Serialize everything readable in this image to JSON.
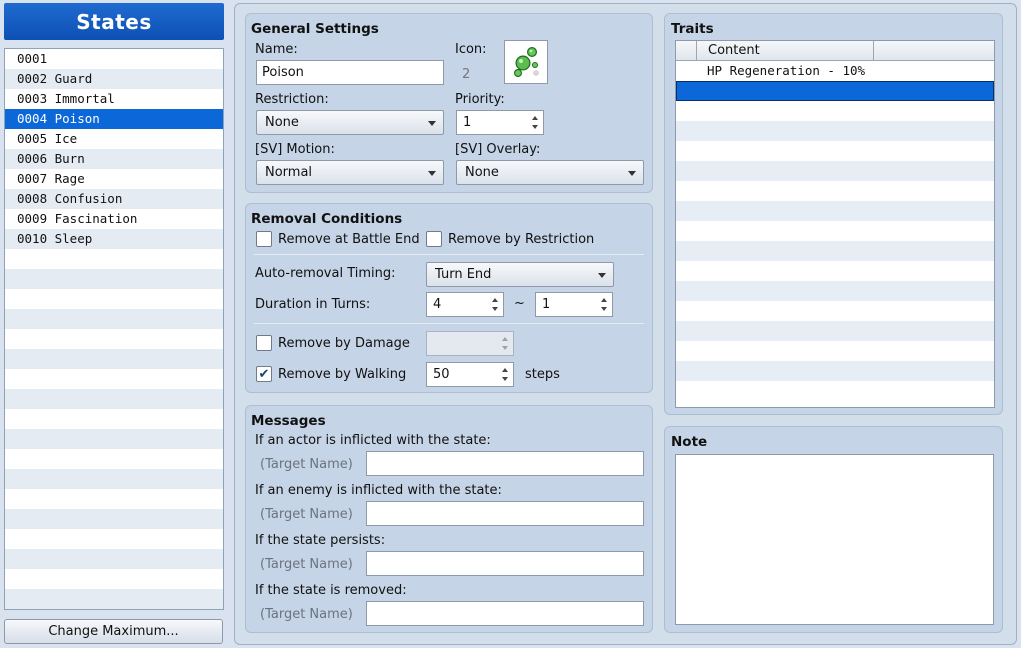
{
  "sidebar": {
    "title": "States",
    "items": [
      {
        "label": "0001"
      },
      {
        "label": "0002 Guard"
      },
      {
        "label": "0003 Immortal"
      },
      {
        "label": "0004 Poison",
        "selected": true
      },
      {
        "label": "0005 Ice"
      },
      {
        "label": "0006 Burn"
      },
      {
        "label": "0007 Rage"
      },
      {
        "label": "0008 Confusion"
      },
      {
        "label": "0009 Fascination"
      },
      {
        "label": "0010 Sleep"
      }
    ],
    "change_max_label": "Change Maximum..."
  },
  "general": {
    "title": "General Settings",
    "name_label": "Name:",
    "name_value": "Poison",
    "icon_label": "Icon:",
    "icon_index": "2",
    "icon_name": "poison-bubble-icon",
    "restriction_label": "Restriction:",
    "restriction_value": "None",
    "priority_label": "Priority:",
    "priority_value": "1",
    "sv_motion_label": "[SV] Motion:",
    "sv_motion_value": "Normal",
    "sv_overlay_label": "[SV] Overlay:",
    "sv_overlay_value": "None"
  },
  "removal": {
    "title": "Removal Conditions",
    "remove_battle_end_label": "Remove at Battle End",
    "remove_battle_end_checked": false,
    "remove_restriction_label": "Remove by Restriction",
    "remove_restriction_checked": false,
    "auto_timing_label": "Auto-removal Timing:",
    "auto_timing_value": "Turn End",
    "duration_label": "Duration in Turns:",
    "duration_min": "4",
    "duration_sep": "~",
    "duration_max": "1",
    "remove_damage_label": "Remove by Damage",
    "remove_damage_checked": false,
    "remove_damage_value": "",
    "remove_walking_label": "Remove by Walking",
    "remove_walking_checked": true,
    "walking_steps": "50",
    "steps_label": "steps"
  },
  "messages": {
    "title": "Messages",
    "target_placeholder": "(Target Name)",
    "items": [
      {
        "label": "If an actor is inflicted with the state:",
        "value": ""
      },
      {
        "label": "If an enemy is inflicted with the state:",
        "value": ""
      },
      {
        "label": "If the state persists:",
        "value": ""
      },
      {
        "label": "If the state is removed:",
        "value": ""
      }
    ]
  },
  "traits": {
    "title": "Traits",
    "column_header": "Content",
    "rows": [
      "HP Regeneration - 10%"
    ]
  },
  "note": {
    "title": "Note",
    "value": ""
  },
  "colors": {
    "selection": "#0c68d8",
    "header_blue": "#1f6bd0"
  }
}
